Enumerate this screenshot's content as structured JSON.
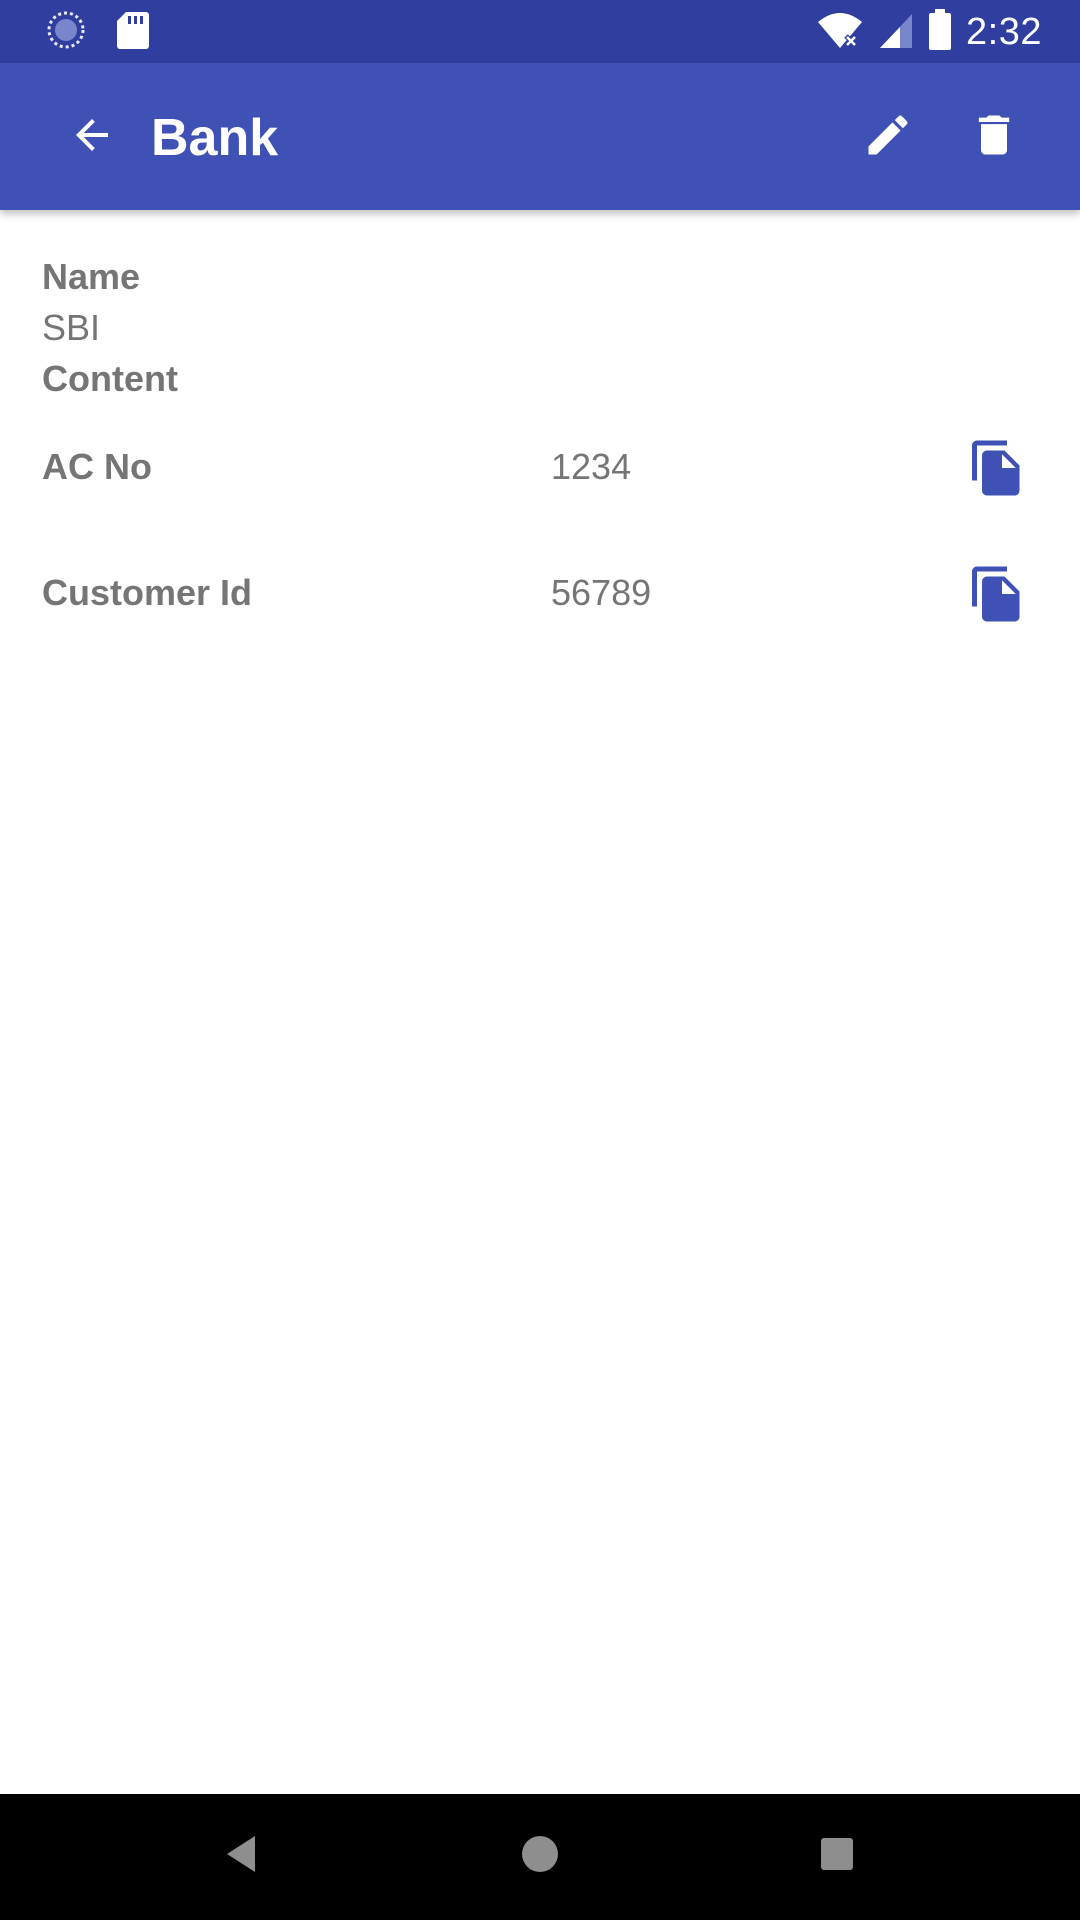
{
  "status_bar": {
    "time": "2:32",
    "left_icons": [
      "loading-spinner-icon",
      "sd-card-icon"
    ],
    "right_icons": [
      "wifi-off-icon",
      "signal-icon",
      "battery-icon"
    ]
  },
  "app_bar": {
    "title": "Bank",
    "back_icon": "arrow-back-icon",
    "edit_icon": "pencil-icon",
    "delete_icon": "trash-icon",
    "color": "#3f51b5"
  },
  "record": {
    "name_label": "Name",
    "name_value": "SBI",
    "content_label": "Content",
    "fields": [
      {
        "label": "AC No",
        "value": "1234",
        "copy_icon": "copy-icon"
      },
      {
        "label": "Customer Id",
        "value": "56789",
        "copy_icon": "copy-icon"
      }
    ]
  },
  "nav_bar": {
    "back_icon": "nav-back-icon",
    "home_icon": "nav-home-icon",
    "recents_icon": "nav-recents-icon"
  },
  "colors": {
    "status_bar": "#303f9f",
    "primary": "#3f51b5",
    "text_secondary": "#757575"
  }
}
